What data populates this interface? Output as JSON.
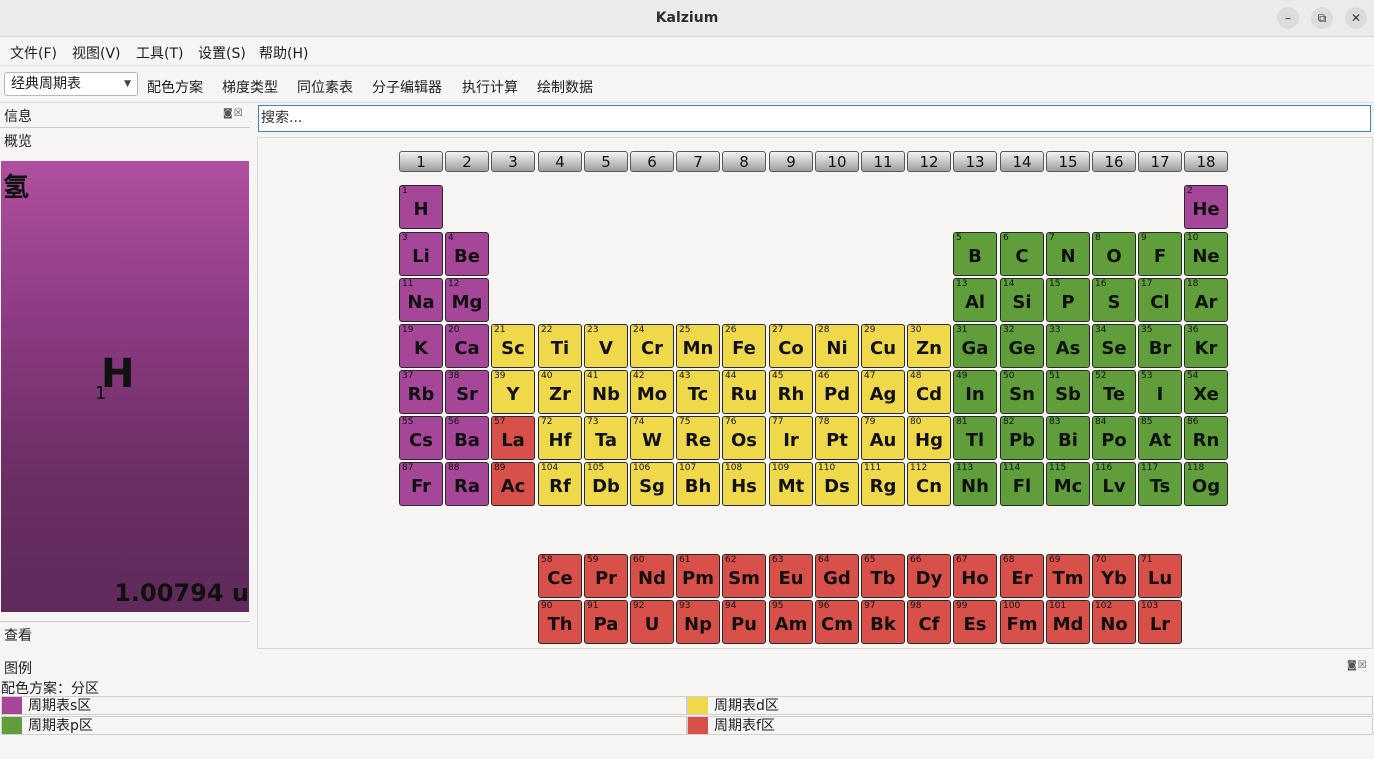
{
  "window": {
    "title": "Kalzium",
    "minimize_icon": "–",
    "restore_icon": "⧉",
    "close_icon": "✕"
  },
  "menu": [
    "文件(F)",
    "视图(V)",
    "工具(T)",
    "设置(S)",
    "帮助(H)"
  ],
  "toolbar": {
    "table_type": "经典周期表",
    "items": [
      "配色方案",
      "梯度类型",
      "同位素表",
      "分子编辑器",
      "执行计算",
      "绘制数据"
    ]
  },
  "dock": {
    "info_title": "信息",
    "overview_tab": "概览",
    "view_tab": "查看",
    "float_close_icons": "◙☒"
  },
  "selected_element": {
    "name": "氢",
    "symbol": "H",
    "number": "1",
    "mass": "1.00794 u"
  },
  "search": {
    "placeholder": "搜索..."
  },
  "groups": [
    "1",
    "2",
    "3",
    "4",
    "5",
    "6",
    "7",
    "8",
    "9",
    "10",
    "11",
    "12",
    "13",
    "14",
    "15",
    "16",
    "17",
    "18"
  ],
  "block_colors": {
    "s": "#a54698",
    "p": "#5f9e3a",
    "d": "#efd94a",
    "f": "#d94f4a"
  },
  "elements": [
    {
      "z": "1",
      "s": "H",
      "g": 1,
      "p": 1,
      "b": "s"
    },
    {
      "z": "2",
      "s": "He",
      "g": 18,
      "p": 1,
      "b": "s"
    },
    {
      "z": "3",
      "s": "Li",
      "g": 1,
      "p": 2,
      "b": "s"
    },
    {
      "z": "4",
      "s": "Be",
      "g": 2,
      "p": 2,
      "b": "s"
    },
    {
      "z": "5",
      "s": "B",
      "g": 13,
      "p": 2,
      "b": "p"
    },
    {
      "z": "6",
      "s": "C",
      "g": 14,
      "p": 2,
      "b": "p"
    },
    {
      "z": "7",
      "s": "N",
      "g": 15,
      "p": 2,
      "b": "p"
    },
    {
      "z": "8",
      "s": "O",
      "g": 16,
      "p": 2,
      "b": "p"
    },
    {
      "z": "9",
      "s": "F",
      "g": 17,
      "p": 2,
      "b": "p"
    },
    {
      "z": "10",
      "s": "Ne",
      "g": 18,
      "p": 2,
      "b": "p"
    },
    {
      "z": "11",
      "s": "Na",
      "g": 1,
      "p": 3,
      "b": "s"
    },
    {
      "z": "12",
      "s": "Mg",
      "g": 2,
      "p": 3,
      "b": "s"
    },
    {
      "z": "13",
      "s": "Al",
      "g": 13,
      "p": 3,
      "b": "p"
    },
    {
      "z": "14",
      "s": "Si",
      "g": 14,
      "p": 3,
      "b": "p"
    },
    {
      "z": "15",
      "s": "P",
      "g": 15,
      "p": 3,
      "b": "p"
    },
    {
      "z": "16",
      "s": "S",
      "g": 16,
      "p": 3,
      "b": "p"
    },
    {
      "z": "17",
      "s": "Cl",
      "g": 17,
      "p": 3,
      "b": "p"
    },
    {
      "z": "18",
      "s": "Ar",
      "g": 18,
      "p": 3,
      "b": "p"
    },
    {
      "z": "19",
      "s": "K",
      "g": 1,
      "p": 4,
      "b": "s"
    },
    {
      "z": "20",
      "s": "Ca",
      "g": 2,
      "p": 4,
      "b": "s"
    },
    {
      "z": "21",
      "s": "Sc",
      "g": 3,
      "p": 4,
      "b": "d"
    },
    {
      "z": "22",
      "s": "Ti",
      "g": 4,
      "p": 4,
      "b": "d"
    },
    {
      "z": "23",
      "s": "V",
      "g": 5,
      "p": 4,
      "b": "d"
    },
    {
      "z": "24",
      "s": "Cr",
      "g": 6,
      "p": 4,
      "b": "d"
    },
    {
      "z": "25",
      "s": "Mn",
      "g": 7,
      "p": 4,
      "b": "d"
    },
    {
      "z": "26",
      "s": "Fe",
      "g": 8,
      "p": 4,
      "b": "d"
    },
    {
      "z": "27",
      "s": "Co",
      "g": 9,
      "p": 4,
      "b": "d"
    },
    {
      "z": "28",
      "s": "Ni",
      "g": 10,
      "p": 4,
      "b": "d"
    },
    {
      "z": "29",
      "s": "Cu",
      "g": 11,
      "p": 4,
      "b": "d"
    },
    {
      "z": "30",
      "s": "Zn",
      "g": 12,
      "p": 4,
      "b": "d"
    },
    {
      "z": "31",
      "s": "Ga",
      "g": 13,
      "p": 4,
      "b": "p"
    },
    {
      "z": "32",
      "s": "Ge",
      "g": 14,
      "p": 4,
      "b": "p"
    },
    {
      "z": "33",
      "s": "As",
      "g": 15,
      "p": 4,
      "b": "p"
    },
    {
      "z": "34",
      "s": "Se",
      "g": 16,
      "p": 4,
      "b": "p"
    },
    {
      "z": "35",
      "s": "Br",
      "g": 17,
      "p": 4,
      "b": "p"
    },
    {
      "z": "36",
      "s": "Kr",
      "g": 18,
      "p": 4,
      "b": "p"
    },
    {
      "z": "37",
      "s": "Rb",
      "g": 1,
      "p": 5,
      "b": "s"
    },
    {
      "z": "38",
      "s": "Sr",
      "g": 2,
      "p": 5,
      "b": "s"
    },
    {
      "z": "39",
      "s": "Y",
      "g": 3,
      "p": 5,
      "b": "d"
    },
    {
      "z": "40",
      "s": "Zr",
      "g": 4,
      "p": 5,
      "b": "d"
    },
    {
      "z": "41",
      "s": "Nb",
      "g": 5,
      "p": 5,
      "b": "d"
    },
    {
      "z": "42",
      "s": "Mo",
      "g": 6,
      "p": 5,
      "b": "d"
    },
    {
      "z": "43",
      "s": "Tc",
      "g": 7,
      "p": 5,
      "b": "d"
    },
    {
      "z": "44",
      "s": "Ru",
      "g": 8,
      "p": 5,
      "b": "d"
    },
    {
      "z": "45",
      "s": "Rh",
      "g": 9,
      "p": 5,
      "b": "d"
    },
    {
      "z": "46",
      "s": "Pd",
      "g": 10,
      "p": 5,
      "b": "d"
    },
    {
      "z": "47",
      "s": "Ag",
      "g": 11,
      "p": 5,
      "b": "d"
    },
    {
      "z": "48",
      "s": "Cd",
      "g": 12,
      "p": 5,
      "b": "d"
    },
    {
      "z": "49",
      "s": "In",
      "g": 13,
      "p": 5,
      "b": "p"
    },
    {
      "z": "50",
      "s": "Sn",
      "g": 14,
      "p": 5,
      "b": "p"
    },
    {
      "z": "51",
      "s": "Sb",
      "g": 15,
      "p": 5,
      "b": "p"
    },
    {
      "z": "52",
      "s": "Te",
      "g": 16,
      "p": 5,
      "b": "p"
    },
    {
      "z": "53",
      "s": "I",
      "g": 17,
      "p": 5,
      "b": "p"
    },
    {
      "z": "54",
      "s": "Xe",
      "g": 18,
      "p": 5,
      "b": "p"
    },
    {
      "z": "55",
      "s": "Cs",
      "g": 1,
      "p": 6,
      "b": "s"
    },
    {
      "z": "56",
      "s": "Ba",
      "g": 2,
      "p": 6,
      "b": "s"
    },
    {
      "z": "57",
      "s": "La",
      "g": 3,
      "p": 6,
      "b": "f"
    },
    {
      "z": "72",
      "s": "Hf",
      "g": 4,
      "p": 6,
      "b": "d"
    },
    {
      "z": "73",
      "s": "Ta",
      "g": 5,
      "p": 6,
      "b": "d"
    },
    {
      "z": "74",
      "s": "W",
      "g": 6,
      "p": 6,
      "b": "d"
    },
    {
      "z": "75",
      "s": "Re",
      "g": 7,
      "p": 6,
      "b": "d"
    },
    {
      "z": "76",
      "s": "Os",
      "g": 8,
      "p": 6,
      "b": "d"
    },
    {
      "z": "77",
      "s": "Ir",
      "g": 9,
      "p": 6,
      "b": "d"
    },
    {
      "z": "78",
      "s": "Pt",
      "g": 10,
      "p": 6,
      "b": "d"
    },
    {
      "z": "79",
      "s": "Au",
      "g": 11,
      "p": 6,
      "b": "d"
    },
    {
      "z": "80",
      "s": "Hg",
      "g": 12,
      "p": 6,
      "b": "d"
    },
    {
      "z": "81",
      "s": "Tl",
      "g": 13,
      "p": 6,
      "b": "p"
    },
    {
      "z": "82",
      "s": "Pb",
      "g": 14,
      "p": 6,
      "b": "p"
    },
    {
      "z": "83",
      "s": "Bi",
      "g": 15,
      "p": 6,
      "b": "p"
    },
    {
      "z": "84",
      "s": "Po",
      "g": 16,
      "p": 6,
      "b": "p"
    },
    {
      "z": "85",
      "s": "At",
      "g": 17,
      "p": 6,
      "b": "p"
    },
    {
      "z": "86",
      "s": "Rn",
      "g": 18,
      "p": 6,
      "b": "p"
    },
    {
      "z": "87",
      "s": "Fr",
      "g": 1,
      "p": 7,
      "b": "s"
    },
    {
      "z": "88",
      "s": "Ra",
      "g": 2,
      "p": 7,
      "b": "s"
    },
    {
      "z": "89",
      "s": "Ac",
      "g": 3,
      "p": 7,
      "b": "f"
    },
    {
      "z": "104",
      "s": "Rf",
      "g": 4,
      "p": 7,
      "b": "d"
    },
    {
      "z": "105",
      "s": "Db",
      "g": 5,
      "p": 7,
      "b": "d"
    },
    {
      "z": "106",
      "s": "Sg",
      "g": 6,
      "p": 7,
      "b": "d"
    },
    {
      "z": "107",
      "s": "Bh",
      "g": 7,
      "p": 7,
      "b": "d"
    },
    {
      "z": "108",
      "s": "Hs",
      "g": 8,
      "p": 7,
      "b": "d"
    },
    {
      "z": "109",
      "s": "Mt",
      "g": 9,
      "p": 7,
      "b": "d"
    },
    {
      "z": "110",
      "s": "Ds",
      "g": 10,
      "p": 7,
      "b": "d"
    },
    {
      "z": "111",
      "s": "Rg",
      "g": 11,
      "p": 7,
      "b": "d"
    },
    {
      "z": "112",
      "s": "Cn",
      "g": 12,
      "p": 7,
      "b": "d"
    },
    {
      "z": "113",
      "s": "Nh",
      "g": 13,
      "p": 7,
      "b": "p"
    },
    {
      "z": "114",
      "s": "Fl",
      "g": 14,
      "p": 7,
      "b": "p"
    },
    {
      "z": "115",
      "s": "Mc",
      "g": 15,
      "p": 7,
      "b": "p"
    },
    {
      "z": "116",
      "s": "Lv",
      "g": 16,
      "p": 7,
      "b": "p"
    },
    {
      "z": "117",
      "s": "Ts",
      "g": 17,
      "p": 7,
      "b": "p"
    },
    {
      "z": "118",
      "s": "Og",
      "g": 18,
      "p": 7,
      "b": "p"
    },
    {
      "z": "58",
      "s": "Ce",
      "g": 4,
      "p": 9,
      "b": "f"
    },
    {
      "z": "59",
      "s": "Pr",
      "g": 5,
      "p": 9,
      "b": "f"
    },
    {
      "z": "60",
      "s": "Nd",
      "g": 6,
      "p": 9,
      "b": "f"
    },
    {
      "z": "61",
      "s": "Pm",
      "g": 7,
      "p": 9,
      "b": "f"
    },
    {
      "z": "62",
      "s": "Sm",
      "g": 8,
      "p": 9,
      "b": "f"
    },
    {
      "z": "63",
      "s": "Eu",
      "g": 9,
      "p": 9,
      "b": "f"
    },
    {
      "z": "64",
      "s": "Gd",
      "g": 10,
      "p": 9,
      "b": "f"
    },
    {
      "z": "65",
      "s": "Tb",
      "g": 11,
      "p": 9,
      "b": "f"
    },
    {
      "z": "66",
      "s": "Dy",
      "g": 12,
      "p": 9,
      "b": "f"
    },
    {
      "z": "67",
      "s": "Ho",
      "g": 13,
      "p": 9,
      "b": "f"
    },
    {
      "z": "68",
      "s": "Er",
      "g": 14,
      "p": 9,
      "b": "f"
    },
    {
      "z": "69",
      "s": "Tm",
      "g": 15,
      "p": 9,
      "b": "f"
    },
    {
      "z": "70",
      "s": "Yb",
      "g": 16,
      "p": 9,
      "b": "f"
    },
    {
      "z": "71",
      "s": "Lu",
      "g": 17,
      "p": 9,
      "b": "f"
    },
    {
      "z": "90",
      "s": "Th",
      "g": 4,
      "p": 10,
      "b": "f"
    },
    {
      "z": "91",
      "s": "Pa",
      "g": 5,
      "p": 10,
      "b": "f"
    },
    {
      "z": "92",
      "s": "U",
      "g": 6,
      "p": 10,
      "b": "f"
    },
    {
      "z": "93",
      "s": "Np",
      "g": 7,
      "p": 10,
      "b": "f"
    },
    {
      "z": "94",
      "s": "Pu",
      "g": 8,
      "p": 10,
      "b": "f"
    },
    {
      "z": "95",
      "s": "Am",
      "g": 9,
      "p": 10,
      "b": "f"
    },
    {
      "z": "96",
      "s": "Cm",
      "g": 10,
      "p": 10,
      "b": "f"
    },
    {
      "z": "97",
      "s": "Bk",
      "g": 11,
      "p": 10,
      "b": "f"
    },
    {
      "z": "98",
      "s": "Cf",
      "g": 12,
      "p": 10,
      "b": "f"
    },
    {
      "z": "99",
      "s": "Es",
      "g": 13,
      "p": 10,
      "b": "f"
    },
    {
      "z": "100",
      "s": "Fm",
      "g": 14,
      "p": 10,
      "b": "f"
    },
    {
      "z": "101",
      "s": "Md",
      "g": 15,
      "p": 10,
      "b": "f"
    },
    {
      "z": "102",
      "s": "No",
      "g": 16,
      "p": 10,
      "b": "f"
    },
    {
      "z": "103",
      "s": "Lr",
      "g": 17,
      "p": 10,
      "b": "f"
    }
  ],
  "legend": {
    "title": "图例",
    "scheme": "配色方案：分区",
    "items": [
      {
        "label": "周期表s区",
        "color": "#a54698"
      },
      {
        "label": "周期表d区",
        "color": "#efd94a"
      },
      {
        "label": "周期表p区",
        "color": "#5f9e3a"
      },
      {
        "label": "周期表f区",
        "color": "#d94f4a"
      }
    ]
  }
}
